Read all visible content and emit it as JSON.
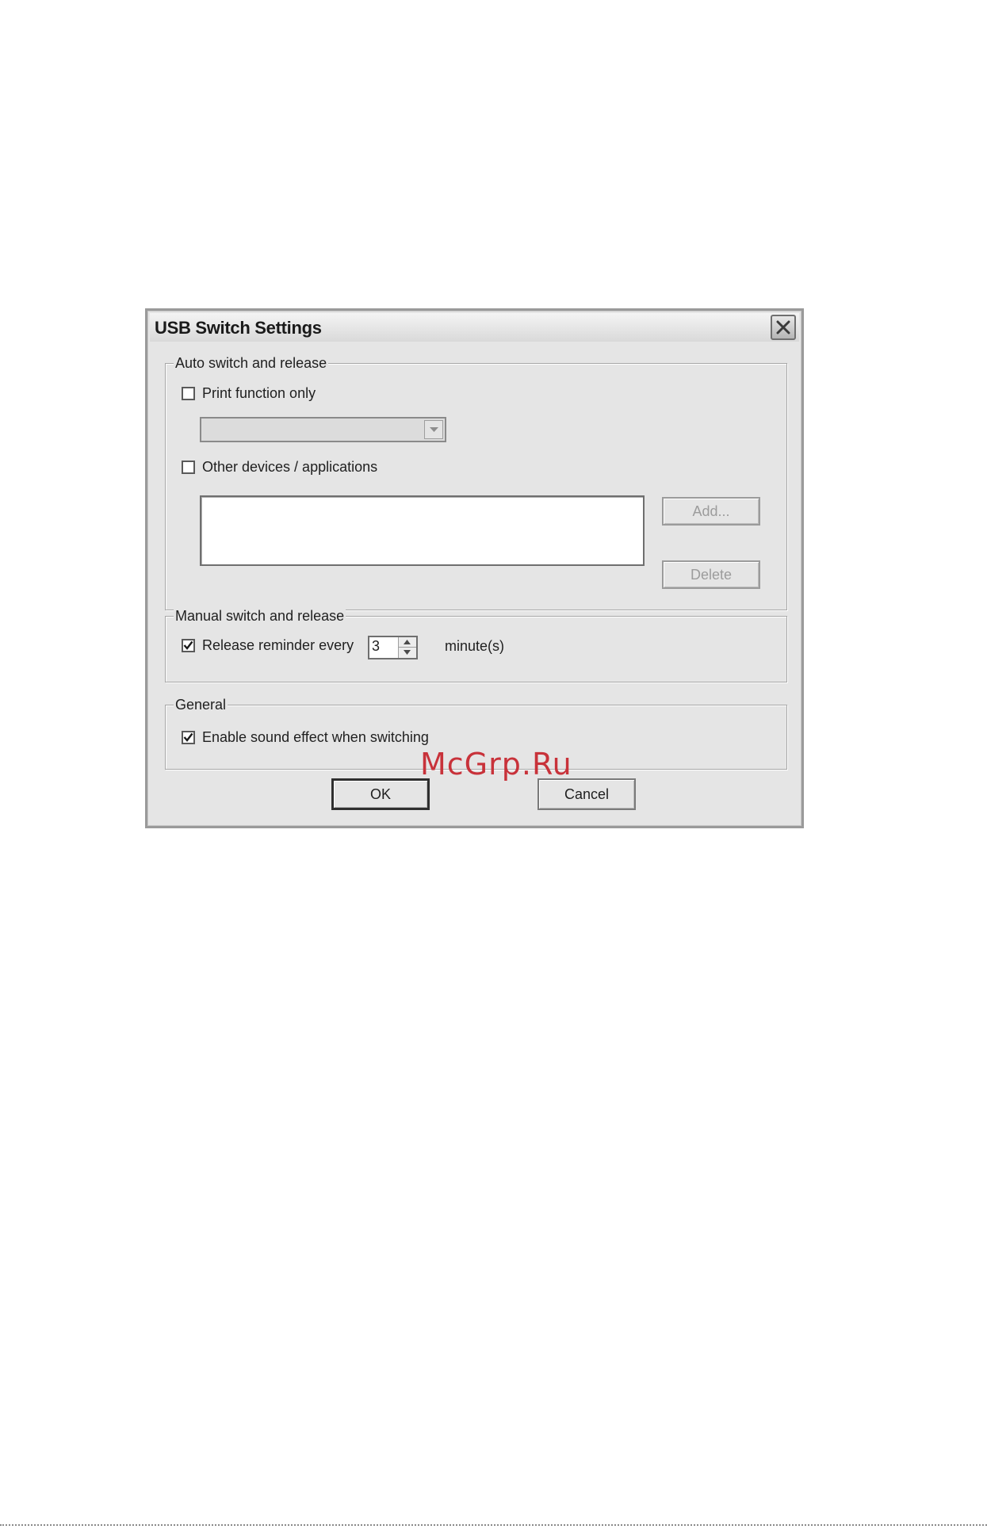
{
  "dialog": {
    "title": "USB Switch Settings",
    "close_icon": "close-icon"
  },
  "auto_group": {
    "legend": "Auto switch and release",
    "print_only": {
      "label": "Print function only",
      "checked": false
    },
    "printer_select": {
      "value": "",
      "enabled": false
    },
    "other_devices": {
      "label": "Other devices / applications",
      "checked": false
    },
    "device_list": [],
    "add_label": "Add...",
    "delete_label": "Delete"
  },
  "manual_group": {
    "legend": "Manual switch and release",
    "reminder": {
      "label": "Release reminder every",
      "checked": true
    },
    "interval_value": "3",
    "unit_label": "minute(s)"
  },
  "general_group": {
    "legend": "General",
    "sound": {
      "label": "Enable sound effect when switching",
      "checked": true
    }
  },
  "footer": {
    "ok_label": "OK",
    "cancel_label": "Cancel"
  },
  "watermark": "McGrp.Ru"
}
